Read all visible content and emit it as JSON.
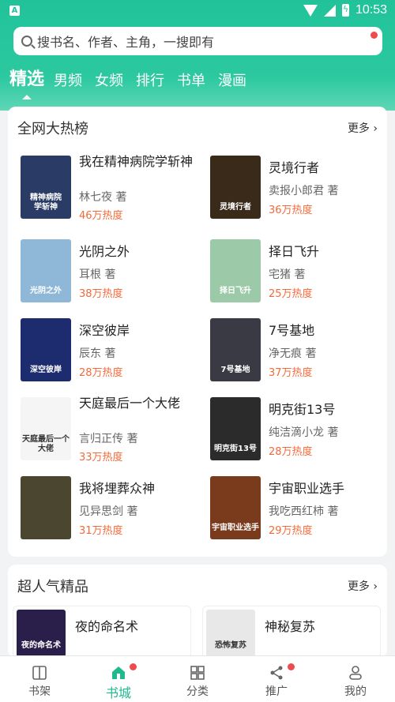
{
  "status": {
    "time": "10:53"
  },
  "search": {
    "placeholder": "搜书名、作者、主角，一搜即有"
  },
  "tabs": [
    "精选",
    "男频",
    "女频",
    "排行",
    "书单",
    "漫画"
  ],
  "section1": {
    "title": "全网大热榜",
    "more": "更多",
    "books": [
      {
        "title": "我在精神病院学斩神",
        "author": "林七夜 著",
        "heat": "46万热度",
        "cover_text": "精神病院\n学斩神",
        "cover_color": "#2a3c66"
      },
      {
        "title": "灵境行者",
        "author": "卖报小郎君 著",
        "heat": "36万热度",
        "cover_text": "灵境行者",
        "cover_color": "#3a2a1a"
      },
      {
        "title": "光阴之外",
        "author": "耳根 著",
        "heat": "38万热度",
        "cover_text": "光阴之外",
        "cover_color": "#8fb8d8"
      },
      {
        "title": "择日飞升",
        "author": "宅猪 著",
        "heat": "25万热度",
        "cover_text": "择日飞升",
        "cover_color": "#9ccaa8"
      },
      {
        "title": "深空彼岸",
        "author": "辰东 著",
        "heat": "28万热度",
        "cover_text": "深空彼岸",
        "cover_color": "#1d2c6e"
      },
      {
        "title": "7号基地",
        "author": "净无痕 著",
        "heat": "37万热度",
        "cover_text": "7号基地",
        "cover_color": "#3a3a44"
      },
      {
        "title": "天庭最后一个大佬",
        "author": "言归正传 著",
        "heat": "33万热度",
        "cover_text": "天庭最后一个大佬",
        "cover_color": "#f5f5f5"
      },
      {
        "title": "明克街13号",
        "author": "纯洁滴小龙 著",
        "heat": "28万热度",
        "cover_text": "明克街13号",
        "cover_color": "#2b2b2b"
      },
      {
        "title": "我将埋葬众神",
        "author": "见异思剑 著",
        "heat": "31万热度",
        "cover_text": "",
        "cover_color": "#4b4630"
      },
      {
        "title": "宇宙职业选手",
        "author": "我吃西红柿 著",
        "heat": "29万热度",
        "cover_text": "宇宙职业选手",
        "cover_color": "#7a3a1c"
      }
    ]
  },
  "section2": {
    "title": "超人气精品",
    "more": "更多",
    "books": [
      {
        "title": "夜的命名术",
        "cover_text": "夜的命名术",
        "cover_color": "#2a1f4a"
      },
      {
        "title": "神秘复苏",
        "cover_text": "恐怖复苏",
        "cover_color": "#e8e8e8"
      }
    ]
  },
  "nav": [
    {
      "label": "书架",
      "icon": "bookshelf-icon",
      "active": false,
      "dot": false
    },
    {
      "label": "书城",
      "icon": "bookstore-icon",
      "active": true,
      "dot": true
    },
    {
      "label": "分类",
      "icon": "category-icon",
      "active": false,
      "dot": false
    },
    {
      "label": "推广",
      "icon": "share-icon",
      "active": false,
      "dot": true
    },
    {
      "label": "我的",
      "icon": "profile-icon",
      "active": false,
      "dot": false
    }
  ],
  "colors": {
    "accent": "#21c29a",
    "heat": "#f36a3a",
    "badge": "#ef4b4b"
  }
}
